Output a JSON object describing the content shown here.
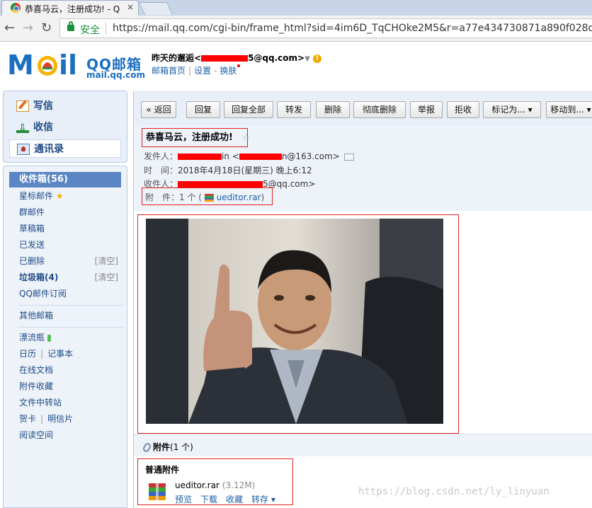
{
  "browser": {
    "tab_title": "恭喜马云，注册成功! - Q",
    "tab_close": "×",
    "secure_label": "安全",
    "url": "https://mail.qq.com/cgi-bin/frame_html?sid=4im6D_TqCHOke2M5&r=a77e434730871a890f028def8c"
  },
  "header": {
    "logo_qq": "QQ邮箱",
    "logo_domain": "mail.qq.com",
    "account_prefix": "昨天的邂逅<",
    "account_suffix": "5@qq.com>",
    "links": {
      "home": "邮箱首页",
      "settings": "设置",
      "skin": "换肤"
    },
    "warn_glyph": "!"
  },
  "quick": {
    "write": "写信",
    "inbox": "收信",
    "contacts": "通讯录"
  },
  "folders": {
    "inbox": "收件箱(56)",
    "starred": "星标邮件",
    "groups": "群邮件",
    "drafts": "草稿箱",
    "sent": "已发送",
    "deleted": "已删除",
    "spam": "垃圾箱(4)",
    "clear": "[清空]",
    "subscriptions": "QQ邮件订阅",
    "other": "其他邮箱",
    "bottle": "漂流瓶",
    "calendar": "日历",
    "notes": "记事本",
    "docs": "在线文档",
    "attachments": "附件收藏",
    "transfer": "文件中转站",
    "cards": "贺卡",
    "postcards": "明信片",
    "reading": "阅读空间"
  },
  "toolbar": {
    "back": "« 返回",
    "reply": "回复",
    "reply_all": "回复全部",
    "forward": "转发",
    "delete": "删除",
    "perm_delete": "彻底删除",
    "report": "举报",
    "reject": "拒收",
    "mark_as": "标记为... ▾",
    "move_to": "移动到... ▾"
  },
  "mail": {
    "subject": "恭喜马云，注册成功!",
    "from_label": "发件人：",
    "from_suffix": "in <",
    "from_email_suffix": "n@163.com>",
    "time_label": "时　间：",
    "time_value": "2018年4月18日(星期三) 晚上6:12",
    "to_label": "收件人：",
    "to_suffix": "5@qq.com>",
    "attach_label": "附　件：",
    "attach_count": "1 个 (",
    "attach_name": "ueditor.rar",
    "attach_close": ")"
  },
  "attachments": {
    "bar_title": "附件",
    "bar_count": "(1 个)",
    "type": "普通附件",
    "file_name": "ueditor.rar",
    "file_size": "(3.12M)",
    "actions": {
      "preview": "预览",
      "download": "下载",
      "collect": "收藏",
      "save": "转存 ▾"
    }
  },
  "watermark": "https://blog.csdn.net/ly_linyuan",
  "colors": {
    "brand_blue": "#1d6fc1",
    "highlight_red": "#e02020",
    "folder_selected": "#5a86c4"
  }
}
